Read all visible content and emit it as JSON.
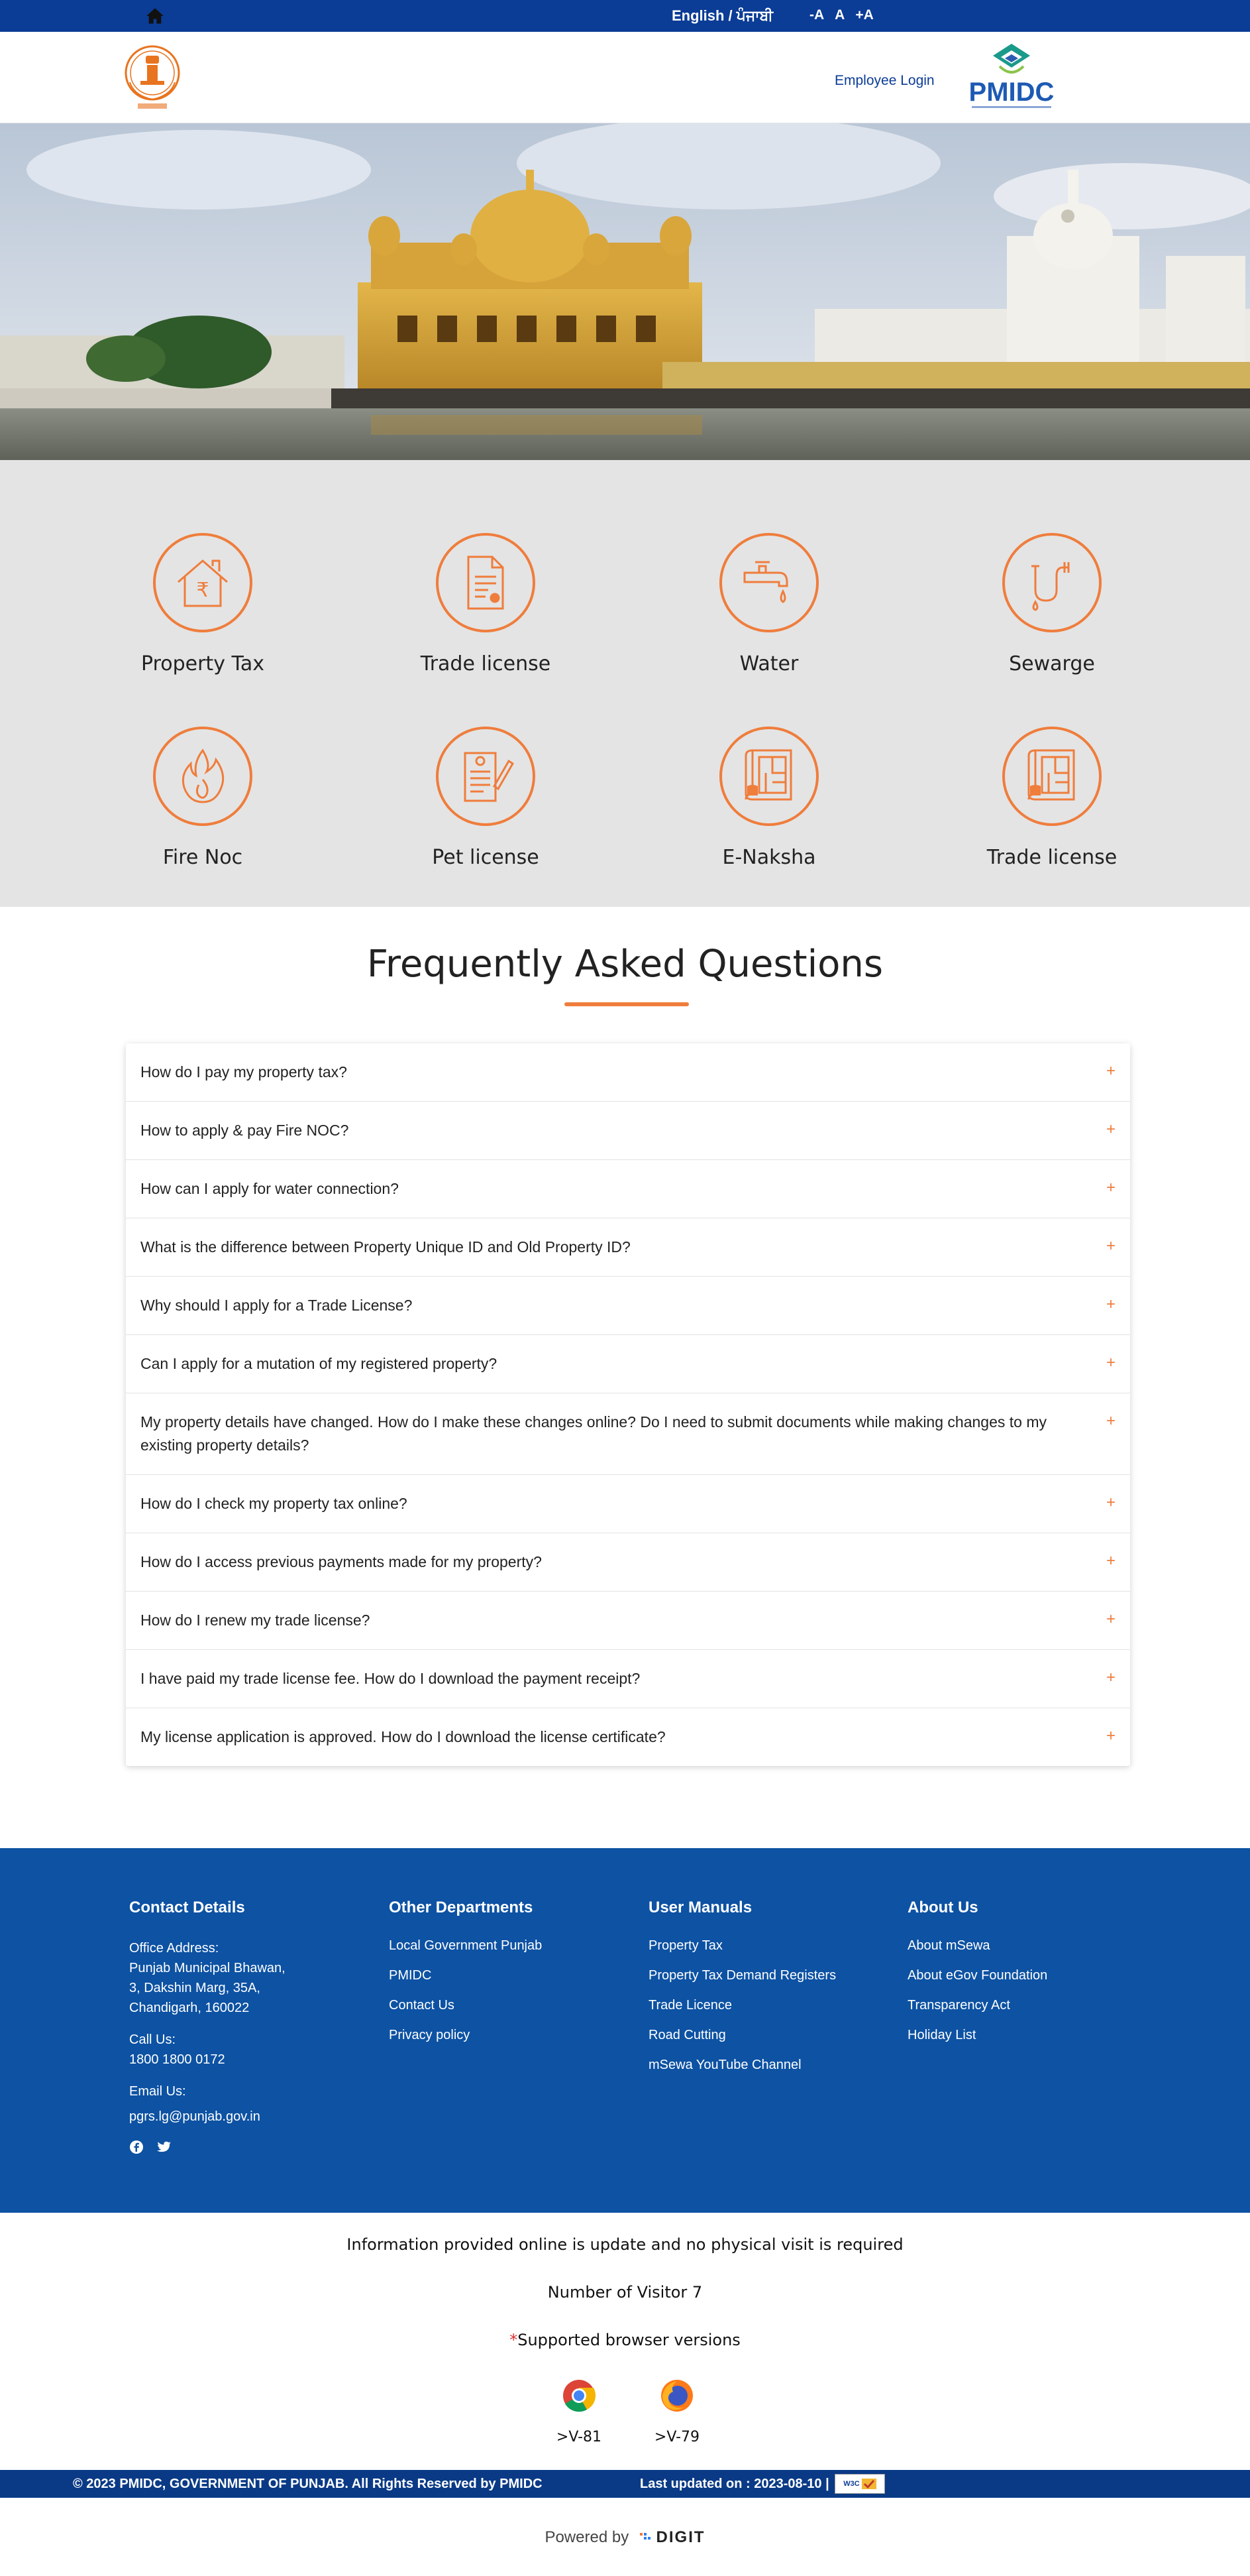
{
  "topbar": {
    "language": "English / ਪੰਜਾਬੀ",
    "font_decrease": "-A",
    "font_normal": "A",
    "font_increase": "+A"
  },
  "header": {
    "employee_login": "Employee Login",
    "pmidc_logo_text": "PMIDC"
  },
  "services": [
    {
      "label": "Property Tax",
      "icon": "property-tax-icon"
    },
    {
      "label": "Trade license",
      "icon": "trade-license-icon"
    },
    {
      "label": "Water",
      "icon": "water-tap-icon"
    },
    {
      "label": "Sewarge",
      "icon": "sewerage-pipe-icon"
    },
    {
      "label": "Fire Noc",
      "icon": "fire-icon"
    },
    {
      "label": "Pet license",
      "icon": "pet-license-icon"
    },
    {
      "label": "E-Naksha",
      "icon": "building-plan-icon"
    },
    {
      "label": "Trade license",
      "icon": "building-plan-icon"
    }
  ],
  "faq": {
    "title": "Frequently Asked Questions",
    "items": [
      "How do I pay my property tax?",
      "How to apply & pay Fire NOC?",
      "How can I apply for water connection?",
      "What is the difference between Property Unique ID and Old Property ID?",
      "Why should I apply for a Trade License?",
      "Can I apply for a mutation of my registered property?",
      "My property details have changed. How do I make these changes online? Do I need to submit documents while making changes to my existing property details?",
      "How do I check my property tax online?",
      "How do I access previous payments made for my property?",
      "How do I renew my trade license?",
      "I have paid my trade license fee. How do I download the payment receipt?",
      "My license application is approved. How do I download the license certificate?"
    ],
    "expand_symbol": "+"
  },
  "footer": {
    "contact": {
      "heading": "Contact Details",
      "office_label": "Office Address:",
      "address1": "Punjab Municipal Bhawan,",
      "address2": "3, Dakshin Marg, 35A,",
      "address3": "Chandigarh, 160022",
      "call_label": "Call Us:",
      "phone": "1800 1800 0172",
      "email_label": "Email Us:",
      "email": "pgrs.lg@punjab.gov.in"
    },
    "other_departments": {
      "heading": "Other Departments",
      "links": [
        "Local Government Punjab",
        "PMIDC",
        "Contact Us",
        "Privacy policy"
      ]
    },
    "user_manuals": {
      "heading": "User Manuals",
      "links": [
        "Property Tax",
        "Property Tax Demand Registers",
        "Trade Licence",
        "Road Cutting",
        "mSewa YouTube Channel"
      ]
    },
    "about": {
      "heading": "About Us",
      "links": [
        "About mSewa",
        "About eGov Foundation",
        "Transparency Act",
        "Holiday List"
      ]
    }
  },
  "info": {
    "notice": "Information provided online is update and no physical visit is required",
    "visitors": "Number of Visitor 7",
    "asterisk": "*",
    "browsers_label": "Supported browser versions",
    "chrome": ">V-81",
    "firefox": ">V-79"
  },
  "bottombar": {
    "copyright": "© 2023 PMIDC, GOVERNMENT OF PUNJAB. All Rights Reserved by PMIDC",
    "updated": "Last updated on : 2023-08-10 |",
    "w3c_text": "W3C"
  },
  "powered": {
    "by": "Powered by",
    "brand": "DIGIT"
  },
  "colors": {
    "accent": "#ef7d3c",
    "brand_blue": "#0b3c96",
    "footer_blue": "#0d52a3"
  }
}
